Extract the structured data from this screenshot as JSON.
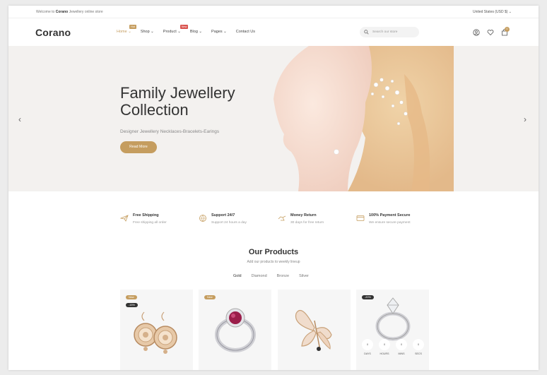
{
  "topbar": {
    "welcome_prefix": "Welcome to ",
    "welcome_brand": "Corano",
    "welcome_suffix": " Jewellery online store",
    "country": "United States (USD $) ⌄"
  },
  "header": {
    "logo": "Corano",
    "nav": [
      {
        "label": "Home ⌄",
        "badge": "Hot"
      },
      {
        "label": "Shop ⌄",
        "badge": ""
      },
      {
        "label": "Product ⌄",
        "badge": "New"
      },
      {
        "label": "Blog ⌄",
        "badge": ""
      },
      {
        "label": "Pages ⌄",
        "badge": ""
      },
      {
        "label": "Contact Us",
        "badge": ""
      }
    ],
    "search_placeholder": "Search our store",
    "cart_count": "0"
  },
  "hero": {
    "title_line1": "Family Jewellery",
    "title_line2": "Collection",
    "subtitle": "Designer Jewellery Necklaces-Bracelets-Earings",
    "button": "Read More"
  },
  "features": [
    {
      "title": "Free Shipping",
      "desc": "Free shipping all order",
      "icon": "airplane-icon"
    },
    {
      "title": "Support 24/7",
      "desc": "Support 24 hours a day",
      "icon": "support-icon"
    },
    {
      "title": "Money Return",
      "desc": "30 days for free return",
      "icon": "money-return-icon"
    },
    {
      "title": "100% Payment Secure",
      "desc": "We ensure secure payment",
      "icon": "secure-payment-icon"
    }
  ],
  "products": {
    "title": "Our Products",
    "subtitle": "Add our products to weekly lineup",
    "tabs": [
      "Gold",
      "Diamond",
      "Bronze",
      "Silver"
    ],
    "cards": [
      {
        "badges": [
          "New",
          "-15%"
        ],
        "icon": "earrings-icon"
      },
      {
        "badges": [
          "New"
        ],
        "icon": "ring-icon"
      },
      {
        "badges": [],
        "icon": "butterfly-brooch-icon"
      },
      {
        "badges": [
          "-20%"
        ],
        "icon": "diamond-ring-icon"
      }
    ],
    "countdown_labels": [
      "DAYS",
      "HOURS",
      "MINS",
      "SECS"
    ]
  },
  "colors": {
    "accent": "#c59d5f",
    "new_badge": "#d9534f"
  }
}
